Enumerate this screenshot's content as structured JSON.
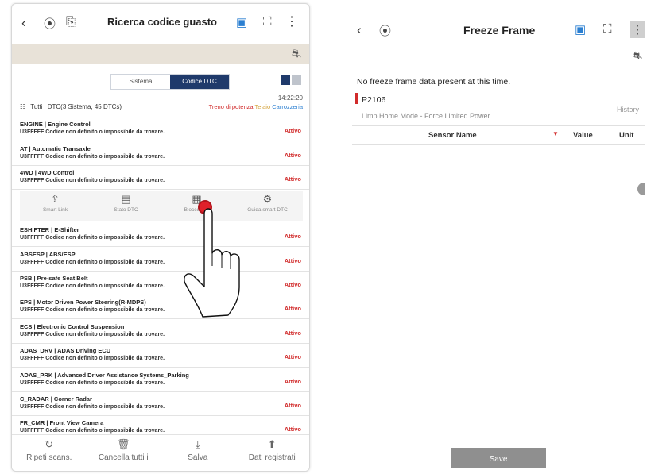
{
  "left": {
    "title": "Ricerca codice guasto",
    "segments": [
      "Sistema",
      "Codice DTC"
    ],
    "time": "14:22:20",
    "summary": "Tutti i DTC(3 Sistema, 45 DTCs)",
    "categories": [
      "Treno di potenza",
      "Telaio",
      "Carrozzeria"
    ],
    "dtcs_top": [
      {
        "system": "ENGINE | Engine Control",
        "code": "U3FFFFF Codice non definito o impossibile da trovare.",
        "status": "Attivo"
      },
      {
        "system": "AT | Automatic Transaxle",
        "code": "U3FFFFF Codice non definito o impossibile da trovare.",
        "status": "Attivo"
      },
      {
        "system": "4WD | 4WD Control",
        "code": "U3FFFFF Codice non definito o impossibile da trovare.",
        "status": "Attivo"
      }
    ],
    "actions": [
      {
        "icon": "share-icon",
        "label": "Smart Link"
      },
      {
        "icon": "dtc-status-icon",
        "label": "Stato DTC"
      },
      {
        "icon": "freeze-frame-icon",
        "label": "Blocco dati"
      },
      {
        "icon": "gear-icon",
        "label": "Guida smart DTC"
      }
    ],
    "dtcs_bottom": [
      {
        "system": "ESHIFTER | E-Shifter",
        "code": "U3FFFFF Codice non definito o impossibile da trovare.",
        "status": "Attivo"
      },
      {
        "system": "ABSESP | ABS/ESP",
        "code": "U3FFFFF Codice non definito o impossibile da trovare.",
        "status": "Attivo"
      },
      {
        "system": "PSB | Pre-safe Seat Belt",
        "code": "U3FFFFF Codice non definito o impossibile da trovare.",
        "status": "Attivo"
      },
      {
        "system": "EPS | Motor Driven Power Steering(R-MDPS)",
        "code": "U3FFFFF Codice non definito o impossibile da trovare.",
        "status": "Attivo"
      },
      {
        "system": "ECS | Electronic Control Suspension",
        "code": "U3FFFFF Codice non definito o impossibile da trovare.",
        "status": "Attivo"
      },
      {
        "system": "ADAS_DRV | ADAS Driving ECU",
        "code": "U3FFFFF Codice non definito o impossibile da trovare.",
        "status": "Attivo"
      },
      {
        "system": "ADAS_PRK | Advanced Driver Assistance Systems_Parking",
        "code": "U3FFFFF Codice non definito o impossibile da trovare.",
        "status": "Attivo"
      },
      {
        "system": "C_RADAR | Corner Radar",
        "code": "U3FFFFF Codice non definito o impossibile da trovare.",
        "status": "Attivo"
      },
      {
        "system": "FR_CMR | Front View Camera",
        "code": "U3FFFFF Codice non definito o impossibile da trovare.",
        "status": "Attivo"
      }
    ],
    "bottom_buttons": [
      {
        "icon": "refresh-icon",
        "label": "Ripeti scans."
      },
      {
        "icon": "trash-icon",
        "label": "Cancella tutti i"
      },
      {
        "icon": "download-icon",
        "label": "Salva"
      },
      {
        "icon": "saved-data-icon",
        "label": "Dati registrati"
      }
    ],
    "colors": {
      "accent": "#1f3a6b",
      "active": "#d12b2b",
      "beige": "#e8e2d8"
    }
  },
  "right": {
    "title": "Freeze Frame",
    "message": "No freeze frame data present at this time.",
    "dtc_code": "P2106",
    "dtc_desc": "Limp Home Mode - Force Limited Power",
    "history": "History",
    "columns": {
      "name": "Sensor Name",
      "value": "Value",
      "unit": "Unit"
    },
    "save": "Save"
  }
}
